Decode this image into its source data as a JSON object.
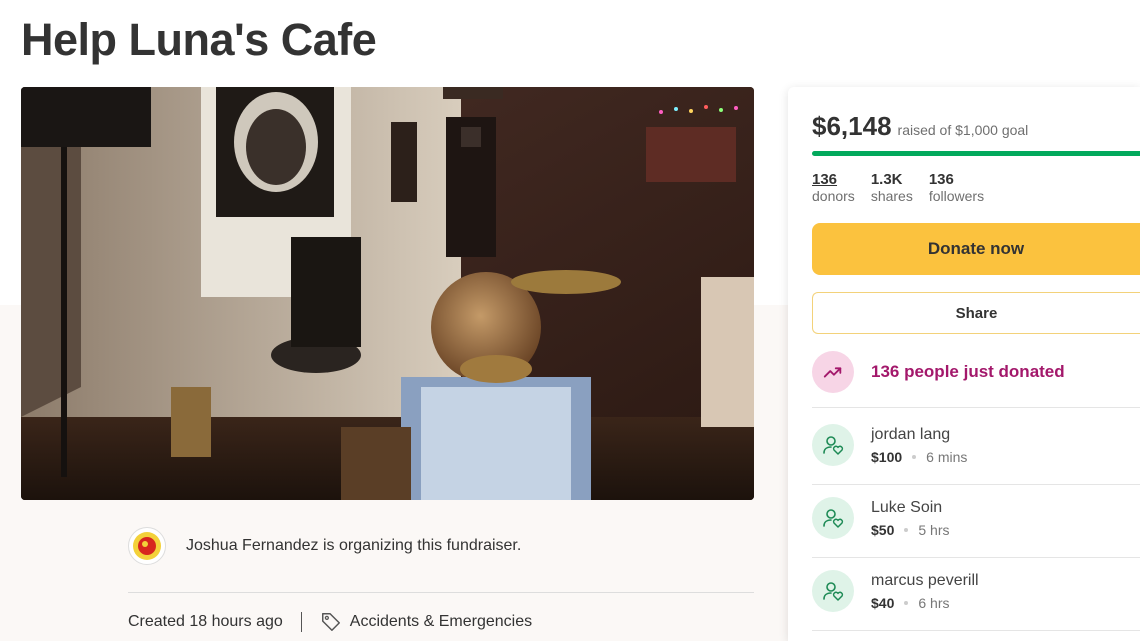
{
  "page": {
    "title": "Help Luna's Cafe"
  },
  "organizer": {
    "text": "Joshua Fernandez is organizing this fundraiser."
  },
  "meta": {
    "created": "Created 18 hours ago",
    "category": "Accidents & Emergencies"
  },
  "fundraiser": {
    "raised": "$6,148",
    "goal_text": "raised of $1,000 goal",
    "progress_fraction": 1.0,
    "stats": [
      {
        "value": "136",
        "label": "donors"
      },
      {
        "value": "1.3K",
        "label": "shares"
      },
      {
        "value": "136",
        "label": "followers"
      }
    ],
    "donate_label": "Donate now",
    "share_label": "Share",
    "trending_text": "136 people just donated"
  },
  "donations": [
    {
      "name": "jordan lang",
      "amount": "$100",
      "time": "6 mins"
    },
    {
      "name": "Luke Soin",
      "amount": "$50",
      "time": "5 hrs"
    },
    {
      "name": "marcus peverill",
      "amount": "$40",
      "time": "6 hrs"
    }
  ],
  "colors": {
    "progress": "#02a95c",
    "donate_button": "#fbc23e",
    "trending_text": "#a3186b",
    "trending_badge": "#f7d5e6",
    "donor_badge": "#dff3e8"
  },
  "icons": {
    "trending": "trending-up-icon",
    "donor": "donor-heart-icon",
    "tag": "tag-icon"
  }
}
